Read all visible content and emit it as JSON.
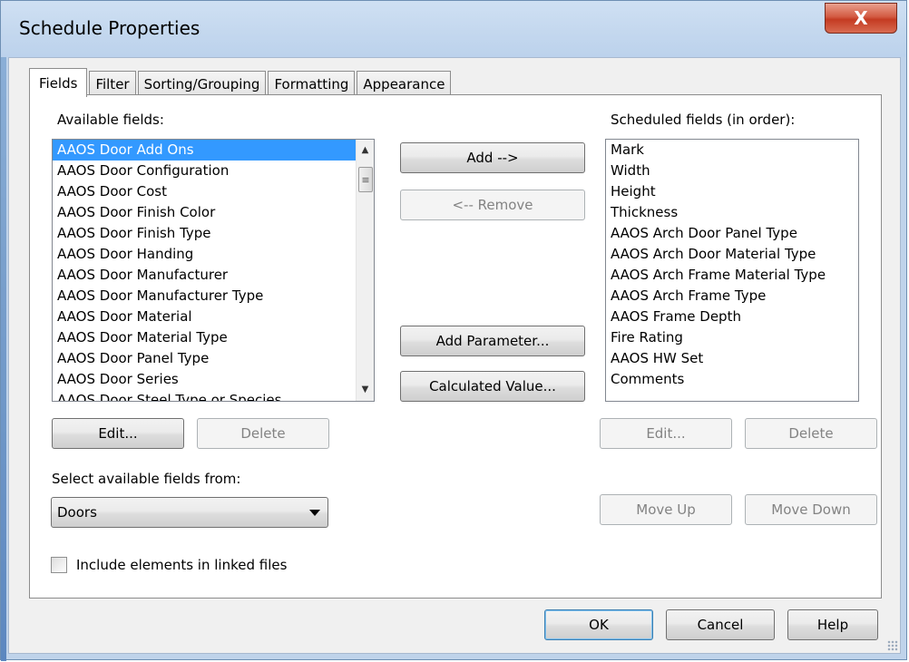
{
  "window": {
    "title": "Schedule Properties",
    "close_glyph": "X"
  },
  "tabs": [
    {
      "label": "Fields",
      "active": true
    },
    {
      "label": "Filter",
      "active": false
    },
    {
      "label": "Sorting/Grouping",
      "active": false
    },
    {
      "label": "Formatting",
      "active": false
    },
    {
      "label": "Appearance",
      "active": false
    }
  ],
  "available": {
    "label": "Available fields:",
    "items": [
      "AAOS Door Add Ons",
      "AAOS Door Configuration",
      "AAOS Door Cost",
      "AAOS Door Finish Color",
      "AAOS Door Finish Type",
      "AAOS Door Handing",
      "AAOS Door Manufacturer",
      "AAOS Door Manufacturer Type",
      "AAOS Door Material",
      "AAOS Door Material Type",
      "AAOS Door Panel Type",
      "AAOS Door Series",
      "AAOS Door Steel Type or Species"
    ],
    "selected_index": 0
  },
  "scheduled": {
    "label": "Scheduled fields (in order):",
    "items": [
      "Mark",
      "Width",
      "Height",
      "Thickness",
      "AAOS Arch Door Panel Type",
      "AAOS Arch Door Material Type",
      "AAOS Arch Frame Material Type",
      "AAOS Arch Frame Type",
      "AAOS Frame Depth",
      "Fire Rating",
      "AAOS HW Set",
      "Comments"
    ]
  },
  "buttons": {
    "add": "Add -->",
    "remove": "<-- Remove",
    "add_parameter": "Add Parameter...",
    "calculated_value": "Calculated Value...",
    "edit_left": "Edit...",
    "delete_left": "Delete",
    "edit_right": "Edit...",
    "delete_right": "Delete",
    "move_up": "Move Up",
    "move_down": "Move Down",
    "ok": "OK",
    "cancel": "Cancel",
    "help": "Help"
  },
  "source": {
    "label": "Select available fields from:",
    "value": "Doors"
  },
  "linked": {
    "label": "Include elements in linked files",
    "checked": false
  },
  "colors": {
    "selection": "#3399ff",
    "frame": "#bfd3ea",
    "close_button": "#c43b22"
  }
}
